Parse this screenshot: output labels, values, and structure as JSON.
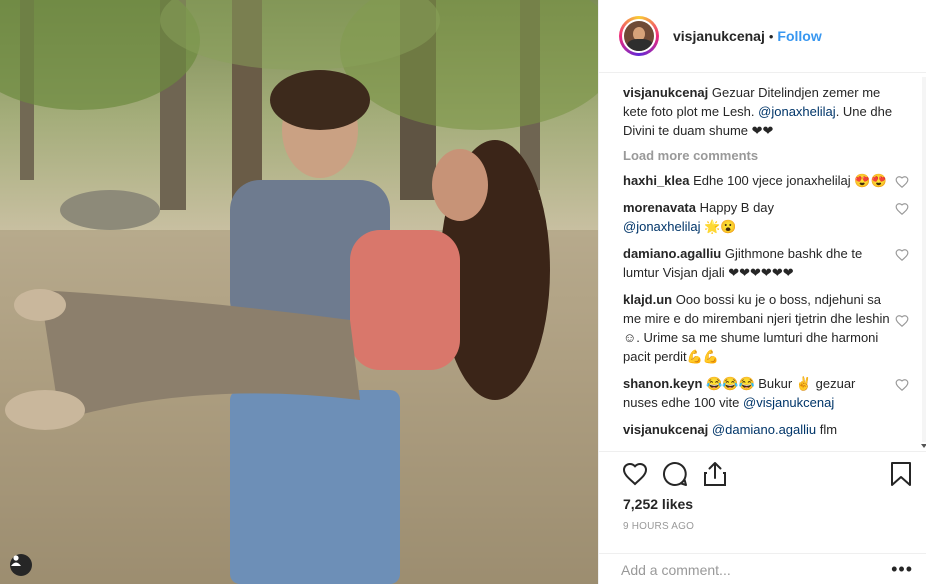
{
  "post": {
    "image_alt": "Couple in a forest, man carrying woman with long curly hair",
    "header": {
      "username": "visjanukcenaj",
      "separator": "•",
      "follow_label": "Follow"
    },
    "caption": {
      "username": "visjanukcenaj",
      "text_before": "Gezuar Ditelindjen zemer me kete foto plot me Lesh.",
      "mention": "@jonaxhelilaj",
      "text_after": ". Une dhe Divini te duam shume ❤❤"
    },
    "load_more_label": "Load more comments",
    "comments": [
      {
        "username": "haxhi_klea",
        "text": "Edhe 100 vjece jonaxhelilaj 😍😍"
      },
      {
        "username": "morenavata",
        "text": "Happy B day",
        "mention": "@jonaxhelilaj",
        "text_after": " 🌟😮"
      },
      {
        "username": "damiano.agalliu",
        "text": "Gjithmone bashk dhe te lumtur Visjan djali ❤❤❤❤❤❤"
      },
      {
        "username": "klajd.un",
        "text": "Ooo bossi ku je o boss, ndjehuni sa me mire e do mirembani njeri tjetrin dhe leshin ☺. Urime sa me shume lumturi dhe harmoni pacit perdit💪💪"
      },
      {
        "username": "shanon.keyn",
        "text": "😂😂😂 Bukur ✌ gezuar nuses edhe 100 vite",
        "mention": "@visjanukcenaj"
      },
      {
        "username": "visjanukcenaj",
        "text": "",
        "mention": "@damiano.agalliu",
        "text_after": " flm"
      }
    ],
    "likes_text": "7,252 likes",
    "time_text": "9 HOURS AGO",
    "add_comment_placeholder": "Add a comment...",
    "more_options": "•••"
  },
  "colors": {
    "link_blue": "#3897f0",
    "mention": "#003569",
    "muted": "#999999",
    "border": "#efefef"
  },
  "icons": [
    "user-tag-icon",
    "heart-icon",
    "comment-icon",
    "share-icon",
    "bookmark-icon",
    "more-options-icon"
  ]
}
